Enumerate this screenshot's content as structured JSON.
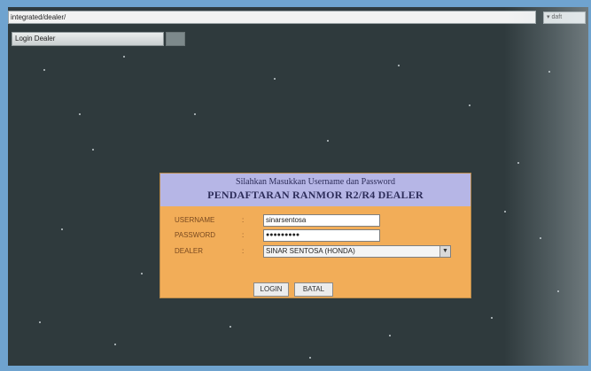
{
  "browser": {
    "address": "integrated/dealer/",
    "search_label": "▾  daft",
    "tab_label": "Login Dealer"
  },
  "login": {
    "subtitle": "Silahkan Masukkan Username dan Password",
    "title": "PENDAFTARAN RANMOR R2/R4 DEALER",
    "username_label": "USERNAME",
    "password_label": "PASSWORD",
    "dealer_label": "DEALER",
    "colon": ":",
    "username_value": "sinarsentosa",
    "password_value": "●●●●●●●●●",
    "dealer_value": "SINAR SENTOSA (HONDA)",
    "login_button": "LOGIN",
    "cancel_button": "BATAL"
  },
  "colors": {
    "background": "#2f3a3d",
    "panel": "#f2ad58",
    "header": "#b6b6e6"
  }
}
